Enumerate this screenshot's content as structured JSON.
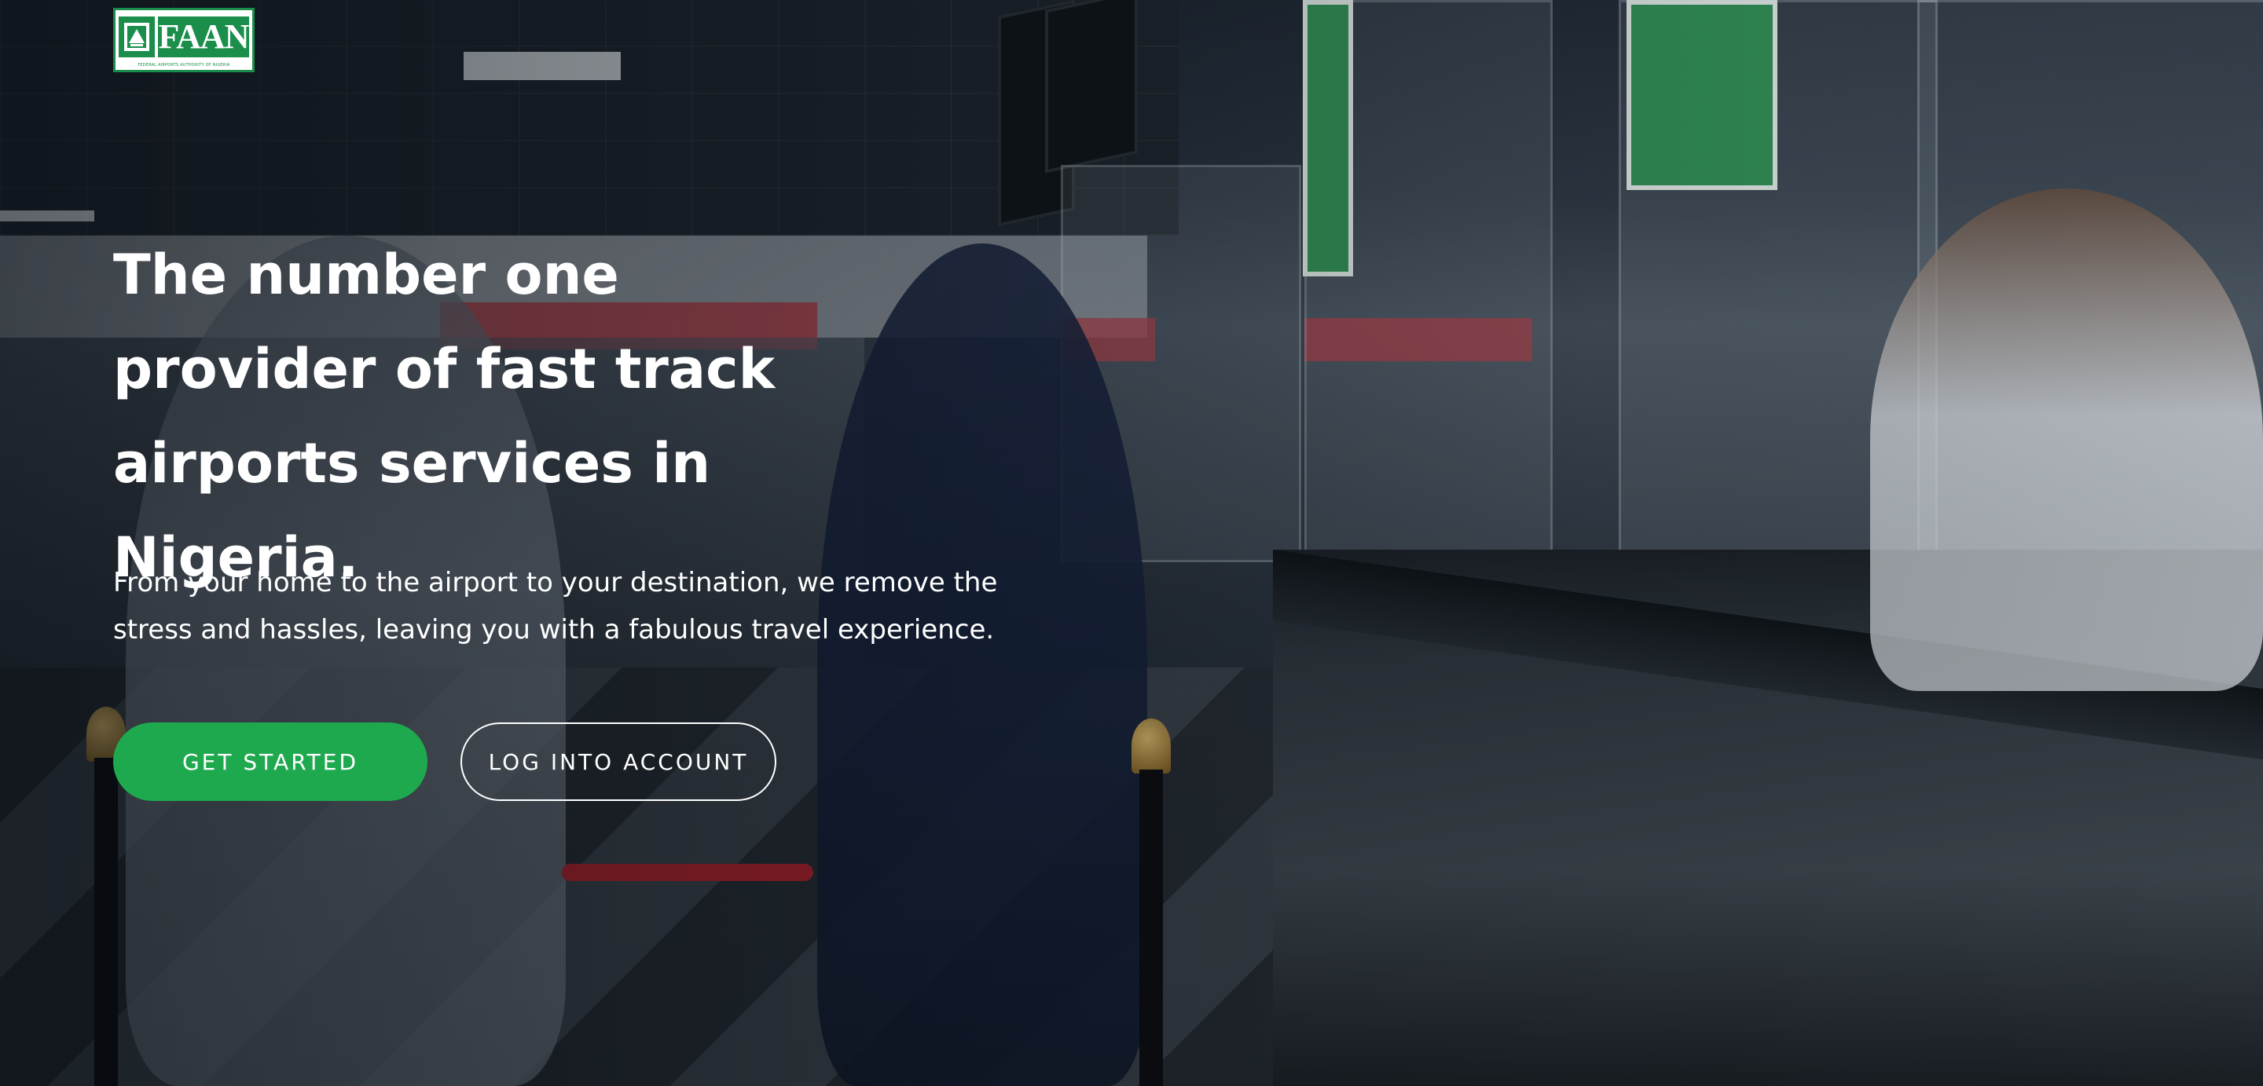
{
  "logo": {
    "text": "FAAN",
    "subtitle": "FEDERAL AIRPORTS AUTHORITY OF NIGERIA",
    "brand_color": "#1a8e4a"
  },
  "hero": {
    "headline_lines": [
      "The number one",
      "provider of fast track",
      "airports services in Nigeria."
    ],
    "description_lines": [
      "From your home to the airport to your destination, we remove the",
      "stress and hassles, leaving you with a fabulous travel experience."
    ]
  },
  "actions": {
    "primary_label": "GET STARTED",
    "secondary_label": "LOG INTO ACCOUNT",
    "primary_color": "#1fa94f"
  },
  "background_image": {
    "description_icon": "airport-counter-photo"
  }
}
